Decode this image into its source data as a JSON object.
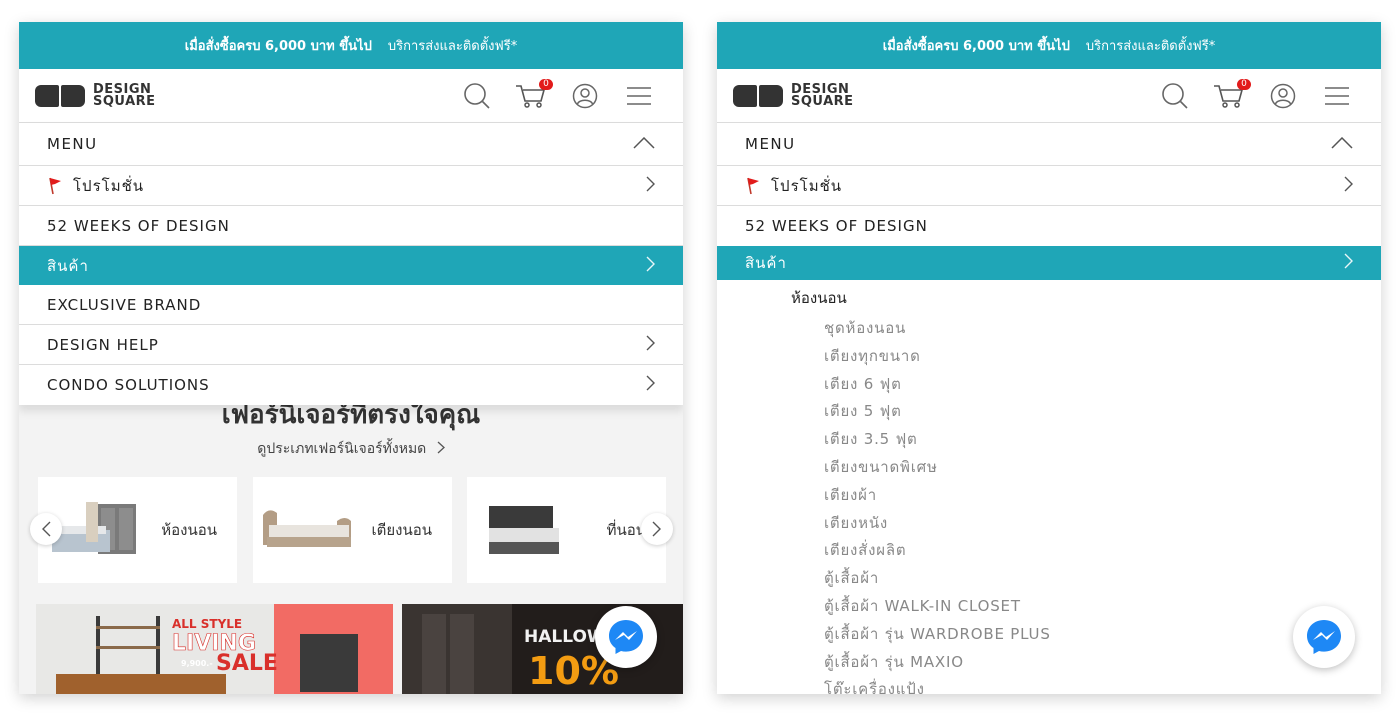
{
  "promo": {
    "text_strong": "เมื่อสั่งซื้อครบ 6,000 บาท ขึ้นไป",
    "text_rest": "บริการส่งและติดตั้งฟรี*"
  },
  "logo": {
    "line1": "DESIGN",
    "line2": "SQUARE"
  },
  "cart": {
    "count": "0"
  },
  "menu": {
    "title": "MENU",
    "items": [
      {
        "label": "โปรโมชั่น"
      },
      {
        "label": "52 WEEKS OF DESIGN"
      },
      {
        "label": "สินค้า"
      },
      {
        "label": "EXCLUSIVE BRAND"
      },
      {
        "label": "DESIGN HELP"
      },
      {
        "label": "CONDO SOLUTIONS"
      }
    ]
  },
  "background": {
    "title": "เฟอร์นิเจอร์ที่ตรงใจคุณ",
    "link": "ดูประเภทเฟอร์นิเจอร์ทั้งหมด",
    "categories": [
      "ห้องนอน",
      "เตียงนอน",
      "ที่นอน"
    ],
    "banner_a": {
      "headline1": "ALL STYLE",
      "headline2": "LIVING",
      "headline3": "SALE",
      "price": "9,900.-"
    },
    "banner_b": {
      "headline": "HALLOWEEN",
      "percent": "10%"
    }
  },
  "submenu": {
    "heading": "ห้องนอน",
    "items": [
      "ชุดห้องนอน",
      "เตียงทุกขนาด",
      "เตียง 6 ฟุต",
      "เตียง 5 ฟุต",
      "เตียง 3.5 ฟุต",
      "เตียงขนาดพิเศษ",
      "เตียงผ้า",
      "เตียงหนัง",
      "เตียงสั่งผลิต",
      "ตู้เสื้อผ้า",
      "ตู้เสื้อผ้า WALK-IN CLOSET",
      "ตู้เสื้อผ้า รุ่น WARDROBE PLUS",
      "ตู้เสื้อผ้า รุ่น MAXIO",
      "โต๊ะเครื่องแป้ง"
    ]
  },
  "colors": {
    "accent": "#1fa6b7",
    "badge": "#e21b1b",
    "messenger": "#1e88f5"
  }
}
